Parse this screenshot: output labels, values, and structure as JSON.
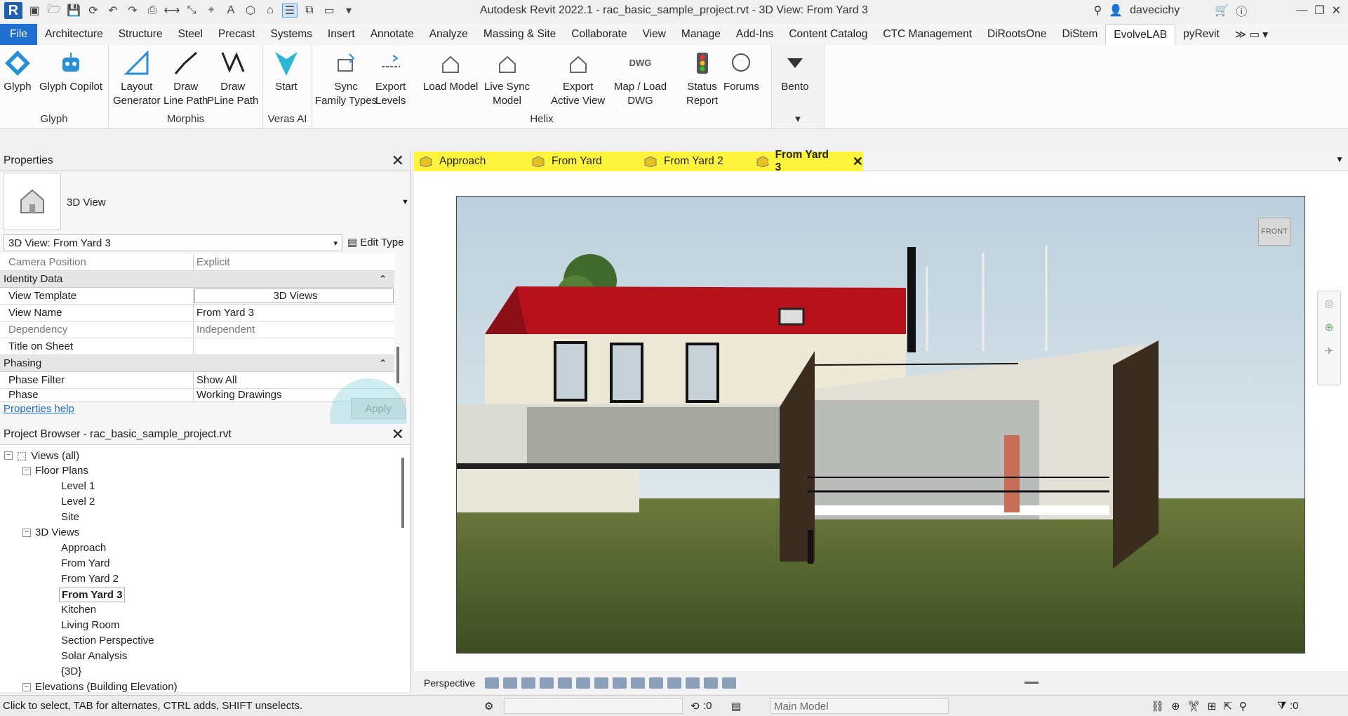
{
  "window": {
    "title": "Autodesk Revit 2022.1 - rac_basic_sample_project.rvt - 3D View: From Yard 3",
    "user": "davecichy"
  },
  "menu": {
    "tabs": [
      "File",
      "Architecture",
      "Structure",
      "Steel",
      "Precast",
      "Systems",
      "Insert",
      "Annotate",
      "Analyze",
      "Massing & Site",
      "Collaborate",
      "View",
      "Manage",
      "Add-Ins",
      "Content Catalog",
      "CTC Management",
      "DiRootsOne",
      "DiStem",
      "EvolveLAB",
      "pyRevit"
    ],
    "active": "EvolveLAB"
  },
  "ribbon": {
    "groups": {
      "glyph": "Glyph",
      "morphis": "Morphis",
      "veras": "Veras AI",
      "helix": "Helix"
    },
    "buttons": {
      "glyph": "Glyph",
      "glyph_copilot": "Glyph Copilot",
      "layout_generator_1": "Layout",
      "layout_generator_2": "Generator",
      "draw_line_1": "Draw",
      "draw_line_2": "Line Path",
      "draw_pline_1": "Draw",
      "draw_pline_2": "PLine Path",
      "start": "Start",
      "sync_1": "Sync",
      "sync_2": "Family Types",
      "export_levels_1": "Export",
      "export_levels_2": "Levels",
      "load_model": "Load Model",
      "live_sync_1": "Live Sync",
      "live_sync_2": "Model",
      "export_view_1": "Export",
      "export_view_2": "Active View",
      "map_dwg_1": "Map / Load",
      "map_dwg_2": "DWG",
      "status_1": "Status",
      "status_2": "Report",
      "forums": "Forums",
      "bento": "Bento",
      "dwg_icon_text": "DWG"
    }
  },
  "properties": {
    "header": "Properties",
    "type_name": "3D View",
    "selector": "3D View: From Yard 3",
    "edit_type": "Edit Type",
    "rows": {
      "camera_position": {
        "k": "Camera Position",
        "v": "Explicit"
      },
      "view_template": {
        "k": "View Template",
        "v": "3D Views"
      },
      "view_name": {
        "k": "View Name",
        "v": "From Yard 3"
      },
      "dependency": {
        "k": "Dependency",
        "v": "Independent"
      },
      "title_on_sheet": {
        "k": "Title on Sheet",
        "v": ""
      },
      "phase_filter": {
        "k": "Phase Filter",
        "v": "Show All"
      },
      "phase": {
        "k": "Phase",
        "v": "Working Drawings"
      }
    },
    "sections": {
      "identity": "Identity Data",
      "phasing": "Phasing"
    },
    "help": "Properties help",
    "apply": "Apply"
  },
  "browser": {
    "header": "Project Browser - rac_basic_sample_project.rvt",
    "root": "Views (all)",
    "floor_plans": "Floor Plans",
    "floor_items": [
      "Level 1",
      "Level 2",
      "Site"
    ],
    "views_3d": "3D Views",
    "items_3d": [
      "Approach",
      "From Yard",
      "From Yard 2",
      "From Yard 3",
      "Kitchen",
      "Living Room",
      "Section Perspective",
      "Solar Analysis",
      "{3D}"
    ],
    "elevations": "Elevations (Building Elevation)"
  },
  "view_tabs": [
    "Approach",
    "From Yard",
    "From Yard 2",
    "From Yard 3"
  ],
  "active_view_tab": "From Yard 3",
  "viewcube_label": "FRONT",
  "view_control": {
    "mode": "Perspective"
  },
  "status": {
    "hint": "Click to select, TAB for alternates, CTRL adds, SHIFT unselects.",
    "workset_count": ":0",
    "model": "Main Model",
    "filter_count": ":0"
  },
  "colors": {
    "accent": "#1f6fd0",
    "tab_yellow": "#fff43c",
    "roof": "#b5121b"
  }
}
